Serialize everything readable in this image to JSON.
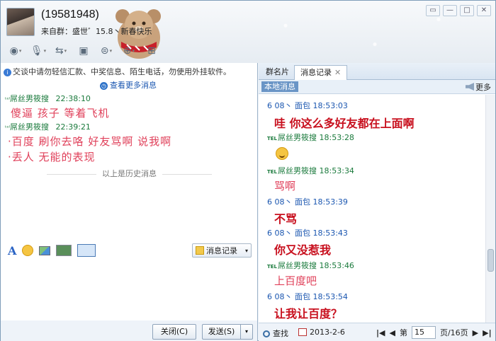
{
  "window": {
    "title": "(19581948)",
    "subtitle": "来自群：盛世゛15.8丶新春快乐",
    "controls": [
      "▭",
      "—",
      "□",
      "✕"
    ]
  },
  "toolbar": {
    "items": [
      {
        "icon": "video-call-icon"
      },
      {
        "icon": "voice-call-icon"
      },
      {
        "icon": "transfer-file-icon"
      },
      {
        "icon": "remote-desktop-icon"
      },
      {
        "icon": "share-screen-icon"
      },
      {
        "icon": "create-discussion-icon"
      },
      {
        "icon": "app-icon"
      }
    ]
  },
  "chat": {
    "notice": "交谈中请勿轻信汇款、中奖信息、陌生电话，勿使用外挂软件。",
    "view_more": "查看更多消息",
    "messages": [
      {
        "sender": "屌丝男筱搜",
        "time": "22:38:10",
        "text": "傻逼 孩子 等着飞机"
      },
      {
        "sender": "屌丝男筱搜",
        "time": "22:39:21",
        "text": "百度 刷你去咯 好友骂啊   说我啊"
      },
      {
        "text": "丢人 无能的表现"
      }
    ],
    "history_divider": "以上是历史消息"
  },
  "composer": {
    "msg_log_label": "消息记录",
    "close_label": "关闭(C)",
    "send_label": "发送(S)"
  },
  "right_panel": {
    "tabs": [
      "群名片",
      "消息记录"
    ],
    "local_label": "本地消息",
    "more_label": "更多",
    "history": [
      {
        "sender": "6 08丶 面包",
        "time": "18:53:03",
        "text": "哇 你这么多好友都在上面啊",
        "style": "red"
      },
      {
        "sender": "屌丝男筱搜",
        "time": "18:53:28",
        "emoji": true
      },
      {
        "sender": "屌丝男筱搜",
        "time": "18:53:34",
        "text": "骂啊",
        "style": "pink"
      },
      {
        "sender": "6 08丶 面包",
        "time": "18:53:39",
        "text": "不骂",
        "style": "red"
      },
      {
        "sender": "6 08丶 面包",
        "time": "18:53:43",
        "text": "你又没惹我",
        "style": "red"
      },
      {
        "sender": "屌丝男筱搜",
        "time": "18:53:46",
        "text": "上百度吧",
        "style": "pink"
      },
      {
        "sender": "6 08丶 面包",
        "time": "18:53:54",
        "text": "让我让百度？",
        "style": "red"
      }
    ],
    "footer": {
      "find_label": "查找",
      "date": "2013-2-6",
      "page_prefix": "第",
      "page_value": "15",
      "page_suffix": "页/16页"
    }
  }
}
